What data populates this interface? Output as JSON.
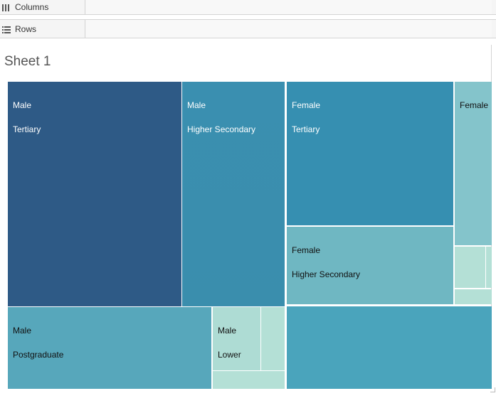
{
  "shelves": {
    "columns_label": "Columns",
    "rows_label": "Rows"
  },
  "sheet": {
    "title": "Sheet 1"
  },
  "colors": {
    "dark_blue": "#2e5a86",
    "teal_mid": "#3a8eaf",
    "teal_light": "#6db6c2",
    "teal_pale": "#84c4cb",
    "mint": "#aedcd4",
    "mint_pale": "#b4e0d6"
  },
  "treemap": {
    "tiles": [
      {
        "id": "male-tertiary",
        "line1": "Male",
        "line2": "Tertiary",
        "color": "#2e5a86",
        "text_color": "#ffffff"
      },
      {
        "id": "male-higher-secondary",
        "line1": "Male",
        "line2": "Higher Secondary",
        "color": "#3a8eaf",
        "text_color": "#ffffff"
      },
      {
        "id": "female-tertiary",
        "line1": "Female",
        "line2": "Tertiary",
        "color": "#368fb1",
        "text_color": "#ffffff"
      },
      {
        "id": "female-unlabeled",
        "line1": "Female",
        "line2": "",
        "color": "#84c4cb",
        "text_color": "#111111"
      },
      {
        "id": "female-higher-secondary",
        "line1": "Female",
        "line2": "Higher Secondary",
        "color": "#6fb7c2",
        "text_color": "#111111"
      },
      {
        "id": "male-postgraduate",
        "line1": "Male",
        "line2": "Postgraduate",
        "color": "#57a7bb",
        "text_color": "#111111"
      },
      {
        "id": "male-lower",
        "line1": "Male",
        "line2": "Lower",
        "color": "#aedcd4",
        "text_color": "#111111"
      }
    ]
  }
}
